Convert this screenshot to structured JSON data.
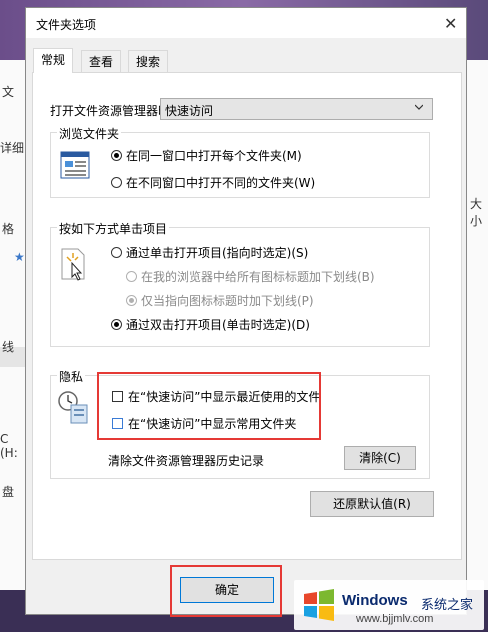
{
  "background": {
    "left_fragments": [
      "文",
      "详细",
      "格",
      "★",
      "线",
      "C (H:",
      "盘"
    ],
    "right_fragments": [
      "大小"
    ]
  },
  "dialog": {
    "title": "文件夹选项",
    "close_glyph": "✕",
    "tabs": [
      {
        "label": "常规",
        "active": true
      },
      {
        "label": "查看",
        "active": false
      },
      {
        "label": "搜索",
        "active": false
      }
    ],
    "open_explorer": {
      "label": "打开文件资源管理器时打",
      "selected": "快速访问"
    },
    "browse": {
      "legend": "浏览文件夹",
      "options": [
        {
          "label": "在同一窗口中打开每个文件夹(M)",
          "checked": true
        },
        {
          "label": "在不同窗口中打开不同的文件夹(W)",
          "checked": false
        }
      ]
    },
    "click": {
      "legend": "按如下方式单击项目",
      "options": [
        {
          "label": "通过单击打开项目(指向时选定)(S)",
          "checked": false,
          "disabled": false
        },
        {
          "label": "在我的浏览器中给所有图标标题加下划线(B)",
          "checked": false,
          "disabled": true
        },
        {
          "label": "仅当指向图标标题时加下划线(P)",
          "checked": true,
          "disabled": true
        },
        {
          "label": "通过双击打开项目(单击时选定)(D)",
          "checked": true,
          "disabled": false
        }
      ]
    },
    "privacy": {
      "legend": "隐私",
      "checkboxes": [
        {
          "label": "在“快速访问”中显示最近使用的文件",
          "checked": false
        },
        {
          "label": "在“快速访问”中显示常用文件夹",
          "checked": false
        }
      ],
      "clear_label": "清除文件资源管理器历史记录",
      "clear_button": "清除(C)"
    },
    "restore_button": "还原默认值(R)",
    "ok_button": "确定"
  },
  "watermark": {
    "brand": "Windows",
    "site_cn": "系统之家",
    "url": "www.bjjmlv.com"
  },
  "colors": {
    "highlight_box": "#e53935",
    "accent": "#0078d7"
  }
}
